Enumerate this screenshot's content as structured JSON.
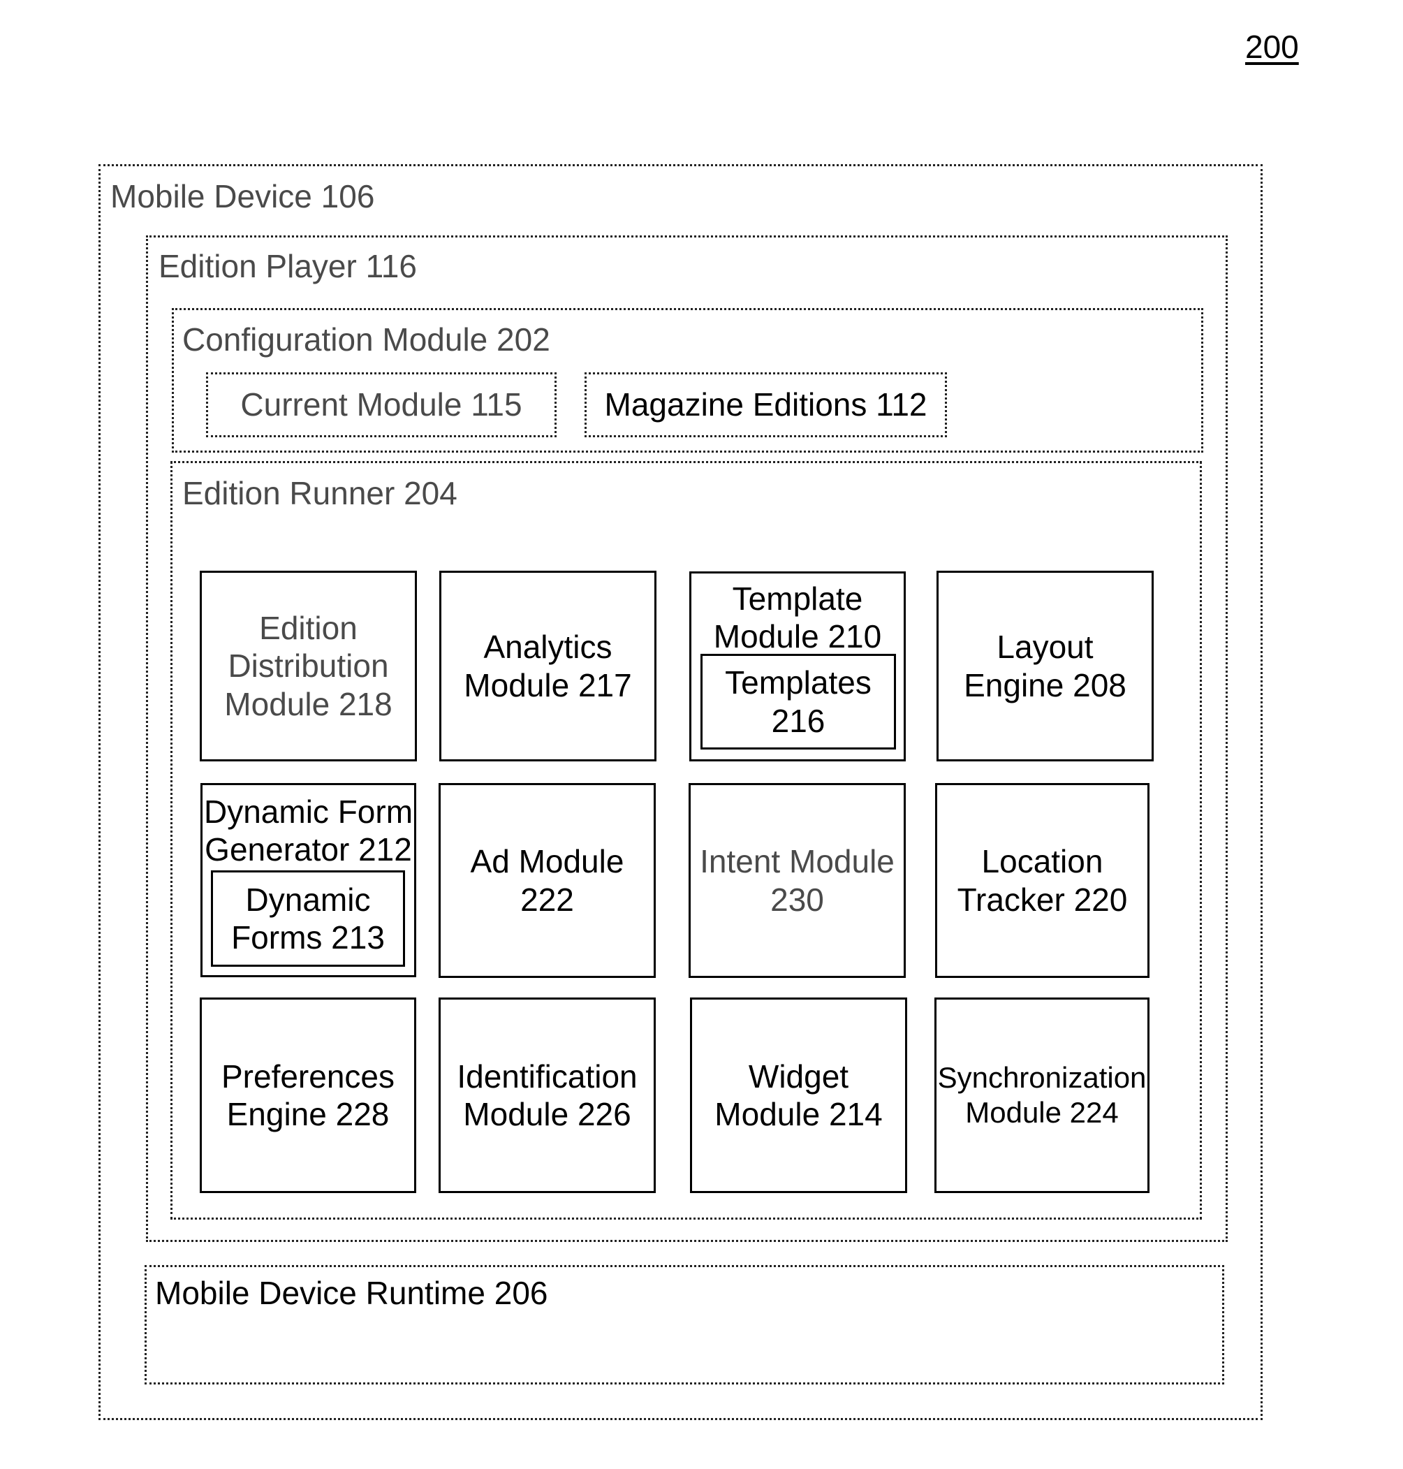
{
  "figure_number": "200",
  "mobile_device": {
    "title": "Mobile Device 106",
    "edition_player": {
      "title": "Edition Player 116",
      "configuration_module": {
        "title": "Configuration Module 202",
        "items": [
          "Current Module 115",
          "Magazine Editions 112"
        ]
      },
      "edition_runner": {
        "title": "Edition Runner 204",
        "modules": [
          {
            "label": "Edition\nDistribution\nModule 218"
          },
          {
            "label": "Analytics\nModule 217"
          },
          {
            "label": "Template\nModule 210",
            "inner": "Templates\n216"
          },
          {
            "label": "Layout\nEngine 208"
          },
          {
            "label": "Dynamic Form\nGenerator 212",
            "inner": "Dynamic\nForms 213"
          },
          {
            "label": "Ad Module\n222"
          },
          {
            "label": "Intent Module\n230"
          },
          {
            "label": "Location\nTracker 220"
          },
          {
            "label": "Preferences\nEngine 228"
          },
          {
            "label": "Identification\nModule 226"
          },
          {
            "label": "Widget\nModule 214"
          },
          {
            "label": "Synchronization\nModule 224"
          }
        ]
      }
    },
    "runtime": {
      "title": "Mobile Device Runtime 206"
    }
  }
}
